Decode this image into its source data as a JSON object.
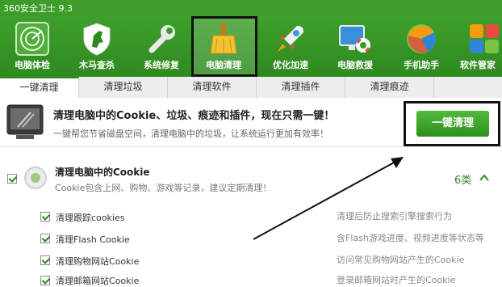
{
  "window": {
    "title": "360安全卫士 9.3"
  },
  "toolbar": {
    "items": [
      {
        "label": "电脑体检",
        "icon": "radar-scan-icon"
      },
      {
        "label": "木马查杀",
        "icon": "horse-shield-icon"
      },
      {
        "label": "系统修复",
        "icon": "wrench-icon"
      },
      {
        "label": "电脑清理",
        "icon": "broom-icon",
        "active": true
      },
      {
        "label": "优化加速",
        "icon": "rocket-icon"
      },
      {
        "label": "电脑救援",
        "icon": "lifebuoy-monitor-icon"
      },
      {
        "label": "手机助手",
        "icon": "phone-ball-icon"
      },
      {
        "label": "软件管家",
        "icon": "apps-grid-icon"
      }
    ]
  },
  "tabs": [
    {
      "label": "一键清理",
      "active": true
    },
    {
      "label": "清理垃圾"
    },
    {
      "label": "清理软件"
    },
    {
      "label": "清理插件"
    },
    {
      "label": "清理痕迹"
    }
  ],
  "banner": {
    "title": "清理电脑中的Cookie、垃圾、痕迹和插件，现在只需一键！",
    "subtitle": "一键帮您节省磁盘空间，清理电脑中的垃圾，让系统运行更加有效率！",
    "button_label": "一键清理"
  },
  "section": {
    "title": "清理电脑中的Cookie",
    "subtitle": "Cookie包含上网、购物、游戏等记录，建议定期清理！",
    "count": "6类",
    "items": [
      {
        "label": "清理跟踪cookies",
        "desc": "清理后防止搜索引擎搜索行为"
      },
      {
        "label": "清理Flash Cookie",
        "desc": "含Flash游戏进度、视频进度等状态等"
      },
      {
        "label": "清理购物网站Cookie",
        "desc": "访问常见购物网站产生的Cookie"
      },
      {
        "label": "清理邮箱网站Cookie",
        "desc": "登录邮箱网站时产生的Cookie"
      }
    ]
  },
  "colors": {
    "brand_green": "#2e8a20",
    "highlight_border": "#111111"
  }
}
